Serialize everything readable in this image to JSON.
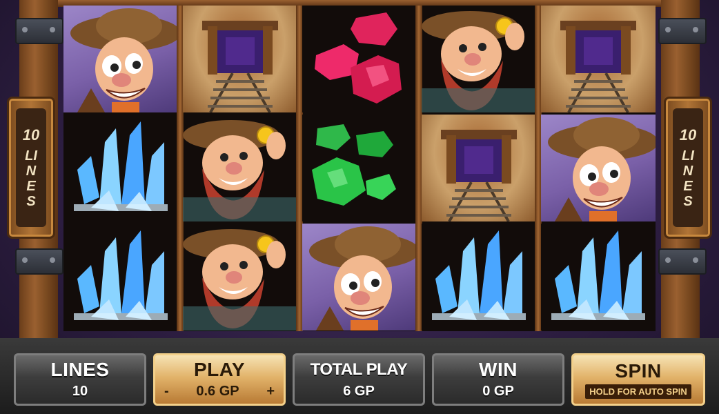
{
  "side_plaques": {
    "left": {
      "number": "10",
      "word": "LINES"
    },
    "right": {
      "number": "10",
      "word": "LINES"
    }
  },
  "reels": [
    [
      "miner",
      "crystal",
      "crystal"
    ],
    [
      "tunnel",
      "bearded-miner",
      "bearded-miner"
    ],
    [
      "ruby",
      "emerald",
      "miner"
    ],
    [
      "bearded-miner",
      "tunnel",
      "crystal"
    ],
    [
      "tunnel",
      "miner",
      "crystal"
    ]
  ],
  "controls": {
    "lines": {
      "label": "LINES",
      "value": "10"
    },
    "play": {
      "label": "PLAY",
      "minus": "-",
      "value": "0.6 GP",
      "plus": "+"
    },
    "total_play": {
      "label": "TOTAL PLAY",
      "value": "6 GP"
    },
    "win": {
      "label": "WIN",
      "value": "0 GP"
    },
    "spin": {
      "label": "SPIN",
      "sublabel": "HOLD FOR AUTO SPIN"
    }
  },
  "colors": {
    "gold": "#e2b36a",
    "wood": "#9a6030",
    "panel_dark": "#3d3d3d"
  }
}
